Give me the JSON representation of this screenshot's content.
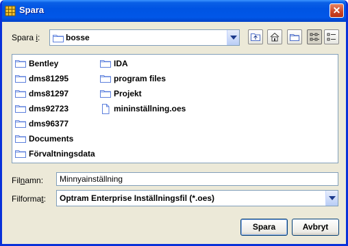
{
  "window": {
    "title": "Spara",
    "close_symbol": "✕"
  },
  "save_in": {
    "label_pre": "Spara ",
    "label_mnemonic": "i",
    "label_post": ":",
    "value": "bosse"
  },
  "toolbar": {
    "icons": [
      "up-one-level-icon",
      "home-icon",
      "new-folder-icon",
      "list-view-icon",
      "details-view-icon"
    ],
    "active_view": "list-view"
  },
  "files": {
    "column1": [
      "Bentley",
      "dms81295",
      "dms81297",
      "dms92723",
      "dms96377",
      "Documents",
      "Förvaltningsdata"
    ],
    "column2": [
      "IDA",
      "program files",
      "Projekt"
    ],
    "file_item": "mininställning.oes"
  },
  "filename": {
    "label_pre": "Fil",
    "label_mnemonic": "n",
    "label_post": "amn:",
    "value": "Minnyainställning"
  },
  "fileformat": {
    "label_pre": "Filforma",
    "label_mnemonic": "t",
    "label_post": ":",
    "value": "Optram Enterprise Inställningsfil (*.oes)"
  },
  "buttons": {
    "save": "Spara",
    "cancel": "Avbryt"
  },
  "colors": {
    "titlebar": "#0054e3",
    "window_bg": "#ece9d8",
    "folder": "#5a7edc"
  }
}
